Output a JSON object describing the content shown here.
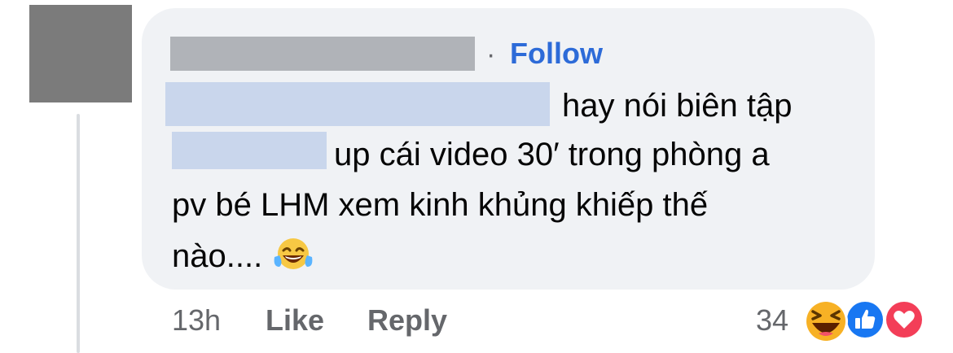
{
  "comment": {
    "author_follow_separator": "·",
    "follow_label": "Follow",
    "lines": [
      "hay nói biên tập",
      "up cái video 30′ trong phòng a",
      "pv bé LHM xem kinh khủng khiếp thế",
      "nào...."
    ],
    "inline_emoji": "tears-of-joy-emoji"
  },
  "actions": {
    "time": "13h",
    "like_label": "Like",
    "reply_label": "Reply"
  },
  "reactions": {
    "count": "34",
    "icons": [
      "haha-reaction-icon",
      "like-reaction-icon",
      "love-reaction-icon"
    ],
    "colors": {
      "like": "#1877f2",
      "love": "#f33e58",
      "haha": "#f7b125"
    }
  }
}
